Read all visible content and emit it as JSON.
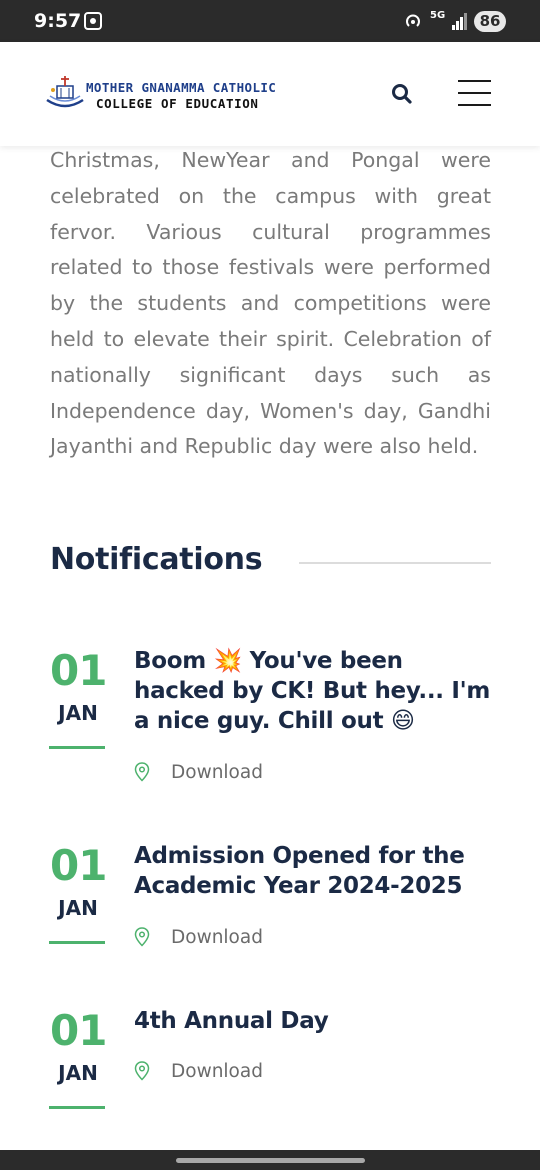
{
  "status_bar": {
    "time": "9:57",
    "network": "5G",
    "battery": "86"
  },
  "header": {
    "brand_line1": "MOTHER GNANAMMA CATHOLIC",
    "brand_line2": "COLLEGE OF EDUCATION",
    "icons": [
      "logo-icon",
      "search-icon",
      "hamburger-menu-icon"
    ]
  },
  "intro_text": "Christmas, NewYear and Pongal were celebrated on the campus with great fervor. Various cultural programmes related to those festivals were performed by the students and competitions were held to elevate their spirit. Celebration of nationally significant days such as Independence day, Women's day, Gandhi Jayanthi and Republic day were also held.",
  "notifications": {
    "title": "Notifications",
    "items": [
      {
        "day": "01",
        "month": "JAN",
        "title_part1": "Boom ",
        "emoji1": "💥",
        "title_part2": " You've been hacked by CK! But hey... I'm a nice guy. Chill out ",
        "emoji2": "😄",
        "download_label": "Download"
      },
      {
        "day": "01",
        "month": "JAN",
        "title": "Admission Opened for the Academic Year 2024-2025",
        "download_label": "Download"
      },
      {
        "day": "01",
        "month": "JAN",
        "title": "4th Annual Day",
        "download_label": "Download"
      }
    ]
  },
  "colors": {
    "accent_green": "#4db26d",
    "heading_navy": "#1b2a45",
    "body_gray": "#7a7a7a",
    "brand_blue": "#1f3f8a"
  }
}
